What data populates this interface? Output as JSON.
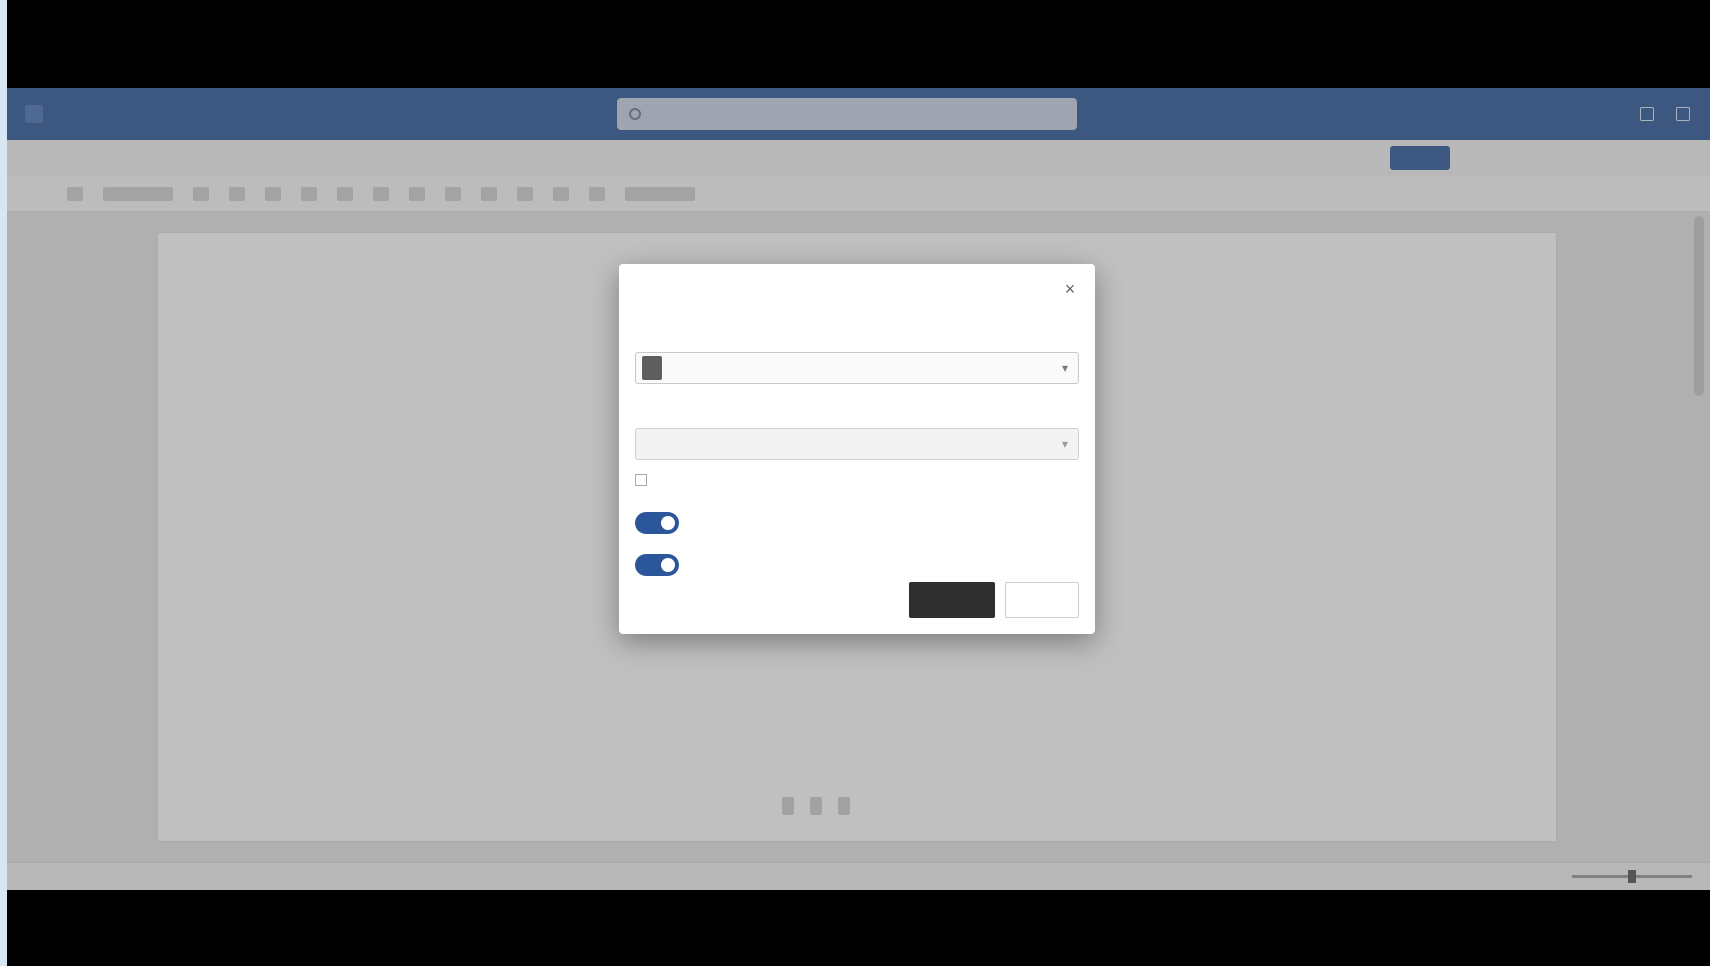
{
  "titlebar": {
    "tabs": [
      "",
      "",
      ""
    ],
    "search_placeholder": ""
  },
  "ribbon": {
    "tabs": [
      "",
      "",
      "",
      "",
      "",
      "",
      "",
      ""
    ],
    "share_label": "",
    "right_text": ""
  },
  "dialog": {
    "title": "",
    "close_glyph": "×",
    "language_label": "",
    "language_value": "",
    "style_label": "",
    "style_value": "",
    "option_text": "",
    "link_text": "",
    "toggle1_label": "",
    "toggle2_label": "",
    "ok_label": "",
    "cancel_label": ""
  },
  "statusbar": {
    "left_text": "",
    "right_text": ""
  },
  "colors": {
    "accent": "#2b579a",
    "overlay": "#5a5a5a"
  }
}
